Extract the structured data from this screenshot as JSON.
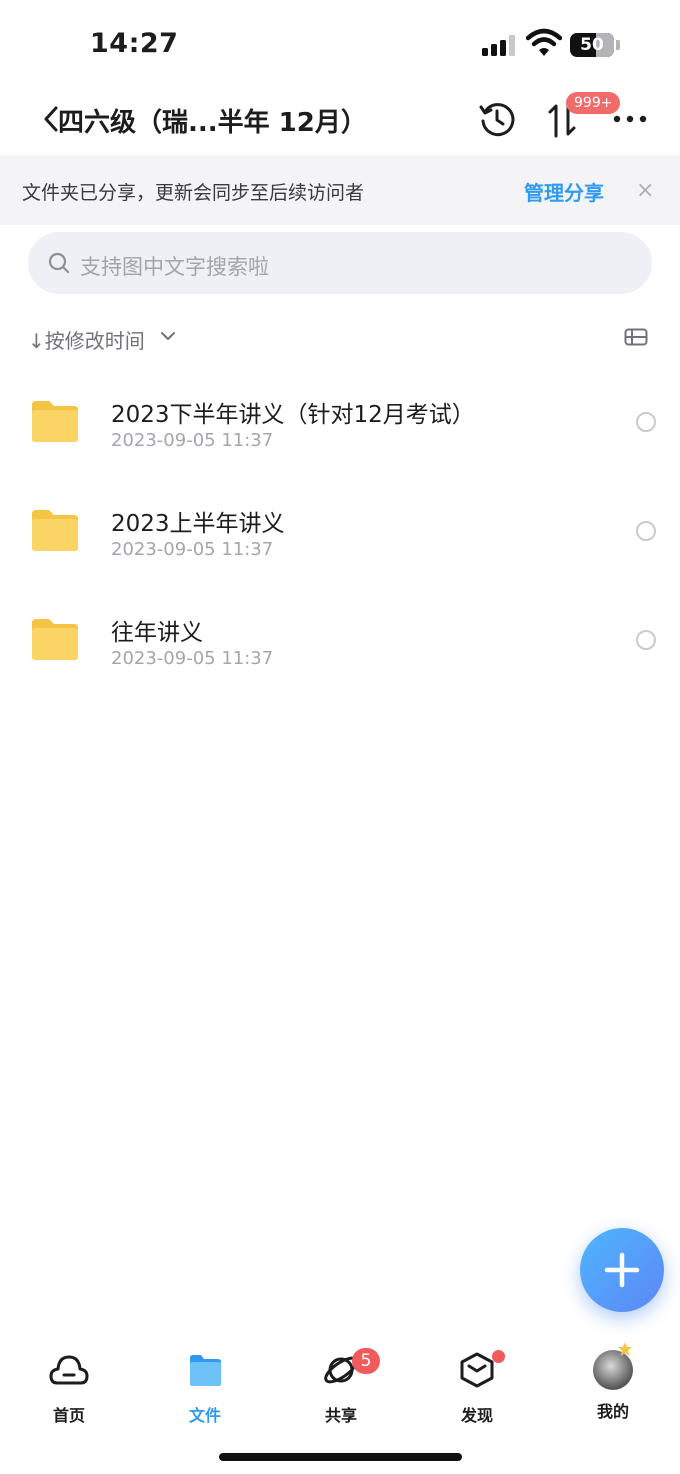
{
  "status_bar": {
    "time": "14:27",
    "battery": "50"
  },
  "header": {
    "title": "四六级（瑞...半年 12月）",
    "transfer_badge": "999+"
  },
  "share_banner": {
    "text": "文件夹已分享，更新会同步至后续访问者",
    "link": "管理分享",
    "close": "×"
  },
  "search": {
    "placeholder": "支持图中文字搜索啦"
  },
  "sort": {
    "label": "↓按修改时间"
  },
  "files": [
    {
      "name": "2023下半年讲义（针对12月考试）",
      "date": "2023-09-05 11:37"
    },
    {
      "name": "2023上半年讲义",
      "date": "2023-09-05 11:37"
    },
    {
      "name": "往年讲义",
      "date": "2023-09-05 11:37"
    }
  ],
  "tabs": [
    {
      "label": "首页",
      "icon": "home-cloud-icon"
    },
    {
      "label": "文件",
      "icon": "folder-icon"
    },
    {
      "label": "共享",
      "icon": "share-orbit-icon",
      "badge": "5"
    },
    {
      "label": "发现",
      "icon": "discover-cube-icon"
    },
    {
      "label": "我的",
      "icon": "avatar"
    }
  ],
  "colors": {
    "accent": "#2f9bf0",
    "badge": "#f05c5c",
    "folder": "#fbd466"
  }
}
